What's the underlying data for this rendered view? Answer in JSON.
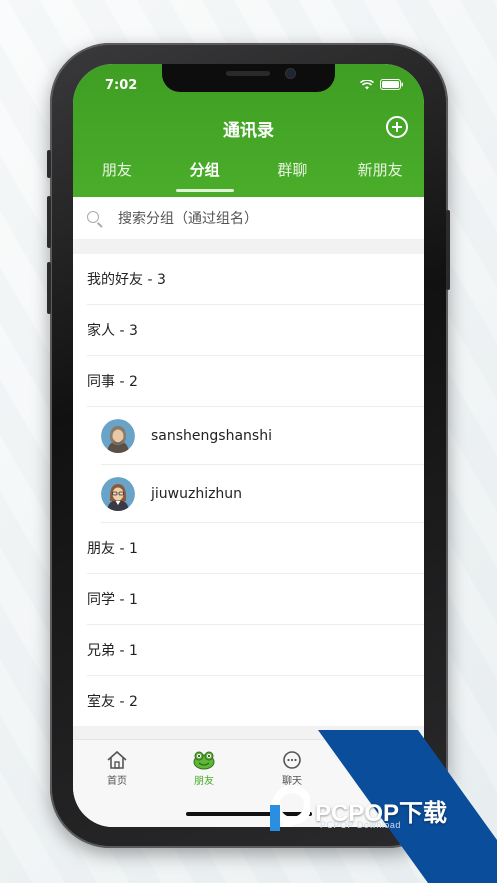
{
  "status_bar": {
    "time": "7:02"
  },
  "header": {
    "title": "通讯录",
    "tabs": [
      {
        "label": "朋友",
        "active": false
      },
      {
        "label": "分组",
        "active": true
      },
      {
        "label": "群聊",
        "active": false
      },
      {
        "label": "新朋友",
        "active": false
      }
    ]
  },
  "search": {
    "placeholder": "搜索分组（通过组名）",
    "value": ""
  },
  "groups": {
    "g1": "我的好友 - 3",
    "g2": "家人 - 3",
    "g3": "同事 - 2",
    "members": [
      "sanshengshanshi",
      "jiuwuzhizhun"
    ],
    "g4": "朋友 - 1",
    "g5": "同学 - 1",
    "g6": "兄弟 - 1",
    "g7": "室友 - 2"
  },
  "tabbar": [
    {
      "label": "首页",
      "icon": "home-icon",
      "active": false
    },
    {
      "label": "朋友",
      "icon": "frog-icon",
      "active": true
    },
    {
      "label": "聊天",
      "icon": "chat-bubble-icon",
      "active": false
    }
  ],
  "watermark": {
    "brand": "PCPOP下载",
    "sub": "PCPOP Download"
  },
  "colors": {
    "accent": "#4aad2a",
    "watermark": "#0a4d9a"
  }
}
